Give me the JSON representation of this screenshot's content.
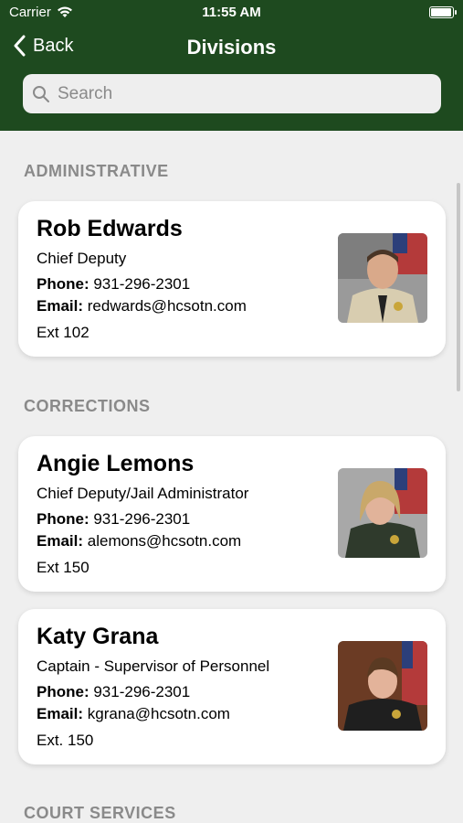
{
  "status": {
    "carrier": "Carrier",
    "time": "11:55 AM",
    "battery_level": 1.0
  },
  "nav": {
    "back": "Back",
    "title": "Divisions"
  },
  "search": {
    "placeholder": "Search"
  },
  "sections": [
    {
      "label": "ADMINISTRATIVE"
    },
    {
      "label": "CORRECTIONS"
    },
    {
      "label": "COURT SERVICES"
    }
  ],
  "contacts": [
    {
      "name": "Rob Edwards",
      "title": "Chief Deputy",
      "phone_label": "Phone:",
      "phone": "931-296-2301",
      "email_label": "Email:",
      "email": "redwards@hcsotn.com",
      "ext": "Ext 102"
    },
    {
      "name": "Angie Lemons",
      "title": "Chief Deputy/Jail Administrator",
      "phone_label": "Phone:",
      "phone": "931-296-2301",
      "email_label": "Email:",
      "email": "alemons@hcsotn.com",
      "ext": "Ext 150"
    },
    {
      "name": "Katy Grana",
      "title": "Captain - Supervisor of Personnel",
      "phone_label": "Phone:",
      "phone": "931-296-2301",
      "email_label": "Email:",
      "email": "kgrana@hcsotn.com",
      "ext": "Ext. 150"
    }
  ],
  "colors": {
    "header": "#1e4a1f",
    "background": "#efefef",
    "section_text": "#8a8a8a"
  }
}
